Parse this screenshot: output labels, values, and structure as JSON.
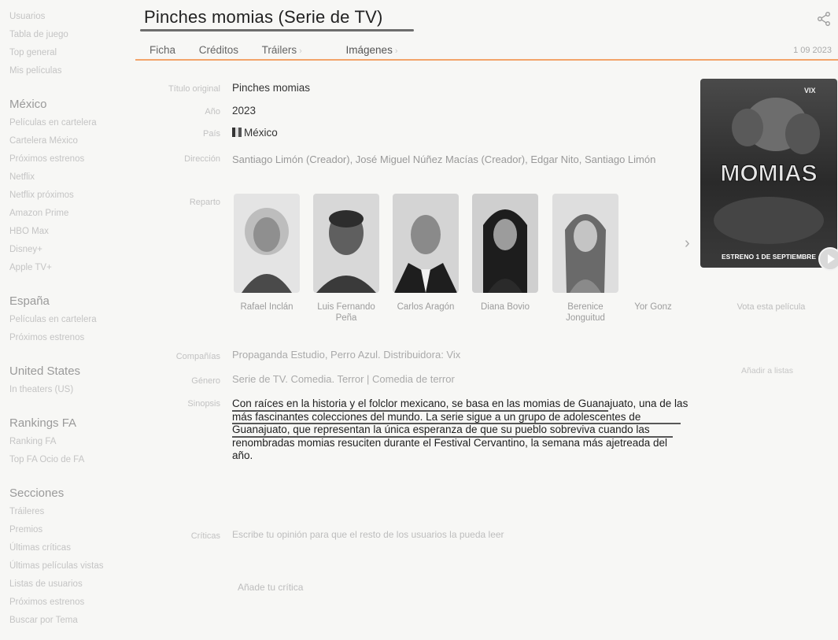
{
  "sidebar": {
    "top": [
      "Usuarios",
      "Tabla de juego",
      "Top general",
      "Mis películas"
    ],
    "groups": [
      {
        "title": "México",
        "items": [
          "Películas en cartelera",
          "Cartelera México",
          "Próximos estrenos",
          "Netflix",
          "Netflix próximos",
          "Amazon Prime",
          "HBO Max",
          "Disney+",
          "Apple TV+"
        ]
      },
      {
        "title": "España",
        "items": [
          "Películas en cartelera",
          "Próximos estrenos"
        ]
      },
      {
        "title": "United States",
        "items": [
          "In theaters (US)"
        ]
      },
      {
        "title": "Rankings FA",
        "items": [
          "Ranking FA",
          "Top FA Ocio de FA"
        ]
      },
      {
        "title": "Secciones",
        "items": [
          "Tráileres",
          "Premios",
          "Últimas críticas",
          "Últimas películas vistas",
          "Listas de usuarios",
          "Próximos estrenos",
          "Buscar por Tema"
        ]
      }
    ]
  },
  "header": {
    "title": "Pinches momias (Serie de TV)",
    "date": "1 09 2023",
    "tabs": [
      "Ficha",
      "Créditos",
      "Tráilers",
      "Imágenes"
    ]
  },
  "info": {
    "original_title_label": "Título original",
    "original_title": "Pinches momias",
    "year_label": "Año",
    "year": "2023",
    "country_label": "País",
    "country": "México",
    "direction_label": "Dirección",
    "direction": "Santiago Limón (Creador), José Miguel Núñez Macías (Creador), Edgar Nito, Santiago Limón",
    "cast_label": "Reparto",
    "company_label": "Compañías",
    "company": "Propaganda Estudio, Perro Azul. Distribuidora: Vix",
    "genre_label": "Género",
    "genre": "Serie de TV. Comedia. Terror | Comedia de terror",
    "synopsis_label": "Sinopsis",
    "synopsis": "Con raíces en la historia y el folclor mexicano, se basa en las momias de Guanajuato, una de las más fascinantes colecciones del mundo. La serie sigue a un grupo de adolescentes de Guanajuato, que representan la única esperanza de que su pueblo sobreviva cuando las renombradas momias resuciten durante el Festival Cervantino, la semana más ajetreada del año.",
    "reviews_label": "Críticas",
    "reviews_text": "Escribe tu opinión para que el resto de los usuarios la pueda leer",
    "add_review": "Añade tu crítica"
  },
  "cast": [
    {
      "name": "Rafael Inclán"
    },
    {
      "name": "Luis Fernando Peña"
    },
    {
      "name": "Carlos Aragón"
    },
    {
      "name": "Diana Bovio"
    },
    {
      "name": "Berenice Jonguitud"
    },
    {
      "name": "Yor Gonz"
    }
  ],
  "sidebar_right": {
    "vote": "Vota esta película",
    "add_list": "Añadir a listas"
  },
  "poster": {
    "brand": "VIX",
    "title": "MOMIAS",
    "tagline": "ESTRENO 1 DE SEPTIEMBRE"
  },
  "colors": {
    "accent": "#f3a46a",
    "title": "#222222"
  }
}
